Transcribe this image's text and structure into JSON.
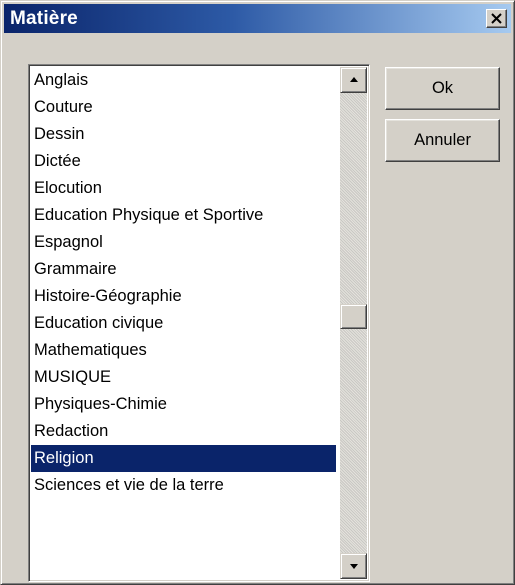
{
  "window": {
    "title": "Matière"
  },
  "subjects": {
    "items": [
      {
        "label": "Anglais"
      },
      {
        "label": "Couture"
      },
      {
        "label": "Dessin"
      },
      {
        "label": "Dictée"
      },
      {
        "label": "Elocution"
      },
      {
        "label": "Education Physique et Sportive"
      },
      {
        "label": "Espagnol"
      },
      {
        "label": "Grammaire"
      },
      {
        "label": "Histoire-Géographie"
      },
      {
        "label": "Education civique"
      },
      {
        "label": "Mathematiques"
      },
      {
        "label": "MUSIQUE"
      },
      {
        "label": "Physiques-Chimie"
      },
      {
        "label": "Redaction"
      },
      {
        "label": "Religion"
      },
      {
        "label": "Sciences et vie de  la terre"
      }
    ],
    "selected": "Religion"
  },
  "buttons": {
    "ok_label": "Ok",
    "cancel_label": "Annuler"
  },
  "icons": {
    "close": "close-icon",
    "scroll_up": "arrow-up-icon",
    "scroll_down": "arrow-down-icon"
  },
  "colors": {
    "selection_background": "#0a246a",
    "title_gradient_start": "#0a246a",
    "title_gradient_end": "#a6caf0",
    "face": "#d4d0c8"
  }
}
